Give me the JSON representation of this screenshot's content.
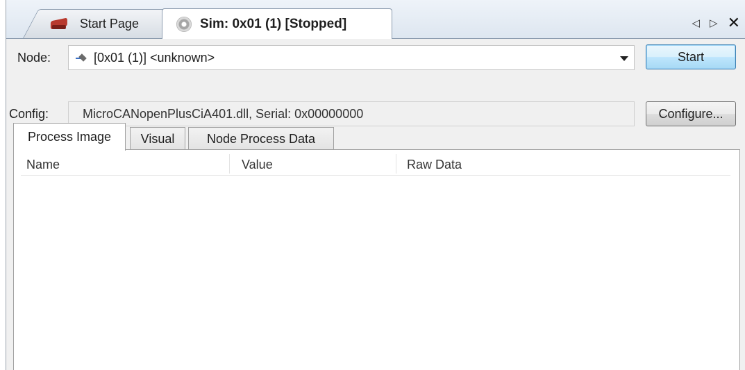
{
  "tabs": {
    "start_page": "Start Page",
    "sim": "Sim: 0x01 (1) [Stopped]"
  },
  "node": {
    "label": "Node:",
    "value": "[0x01 (1)] <unknown>"
  },
  "config": {
    "label": "Config:",
    "value": "MicroCANopenPlusCiA401.dll, Serial: 0x00000000"
  },
  "buttons": {
    "start": "Start",
    "configure": "Configure..."
  },
  "inner_tabs": [
    "Process Image",
    "Visual",
    "Node Process Data"
  ],
  "columns": [
    "Name",
    "Value",
    "Raw Data"
  ],
  "icons": {
    "strip_left": "◁",
    "strip_right": "▷",
    "strip_close": "✕"
  },
  "colors": {
    "accent": "#3c7fb1"
  }
}
